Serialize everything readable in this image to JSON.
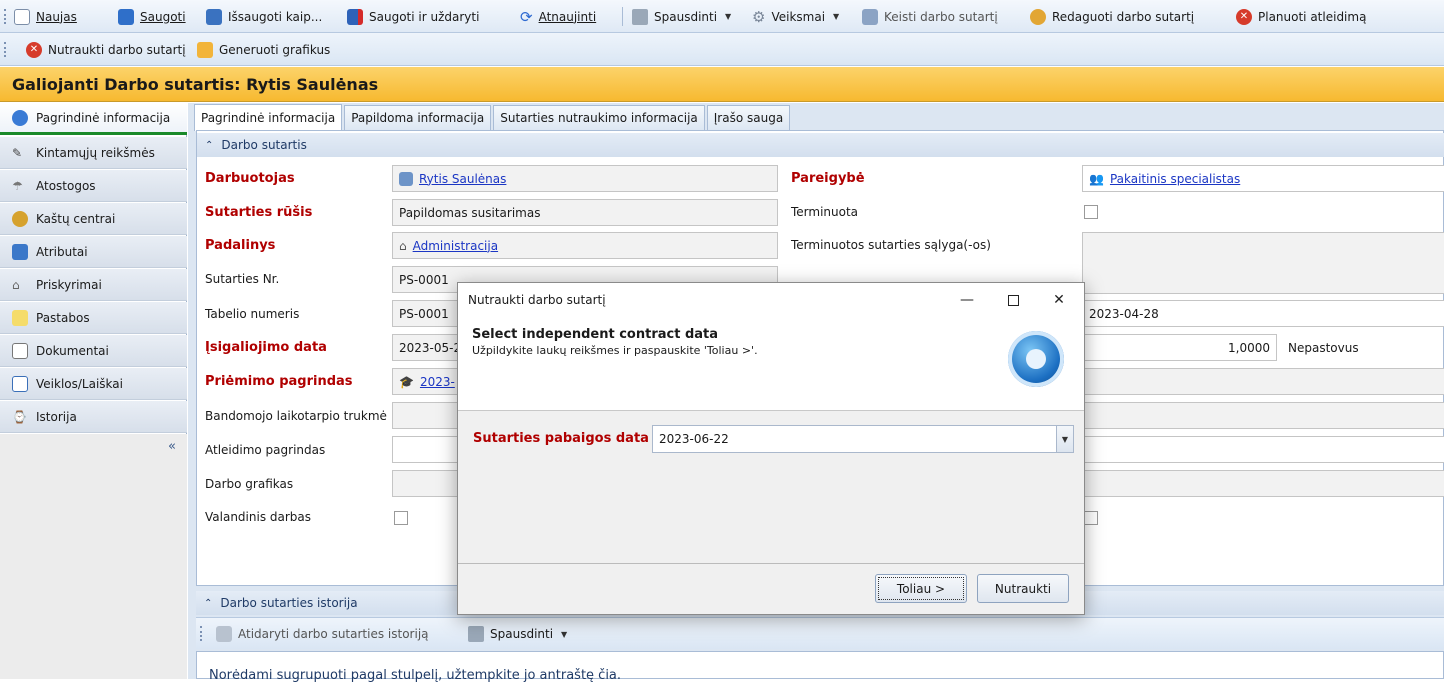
{
  "toolbar1": {
    "new": "Naujas",
    "save": "Saugoti",
    "save_as": "Išsaugoti kaip...",
    "save_close": "Saugoti ir uždaryti",
    "refresh": "Atnaujinti",
    "print": "Spausdinti",
    "actions": "Veiksmai",
    "change_contract": "Keisti darbo sutartį",
    "edit_contract": "Redaguoti darbo sutartį",
    "plan_dismissal": "Planuoti atleidimą"
  },
  "toolbar2": {
    "terminate": "Nutraukti darbo sutartį",
    "generate_schedules": "Generuoti grafikus"
  },
  "window_title": "Galiojanti Darbo sutartis: Rytis Saulėnas",
  "sidebar": {
    "items": [
      {
        "label": "Pagrindinė informacija",
        "icon": "database-icon"
      },
      {
        "label": "Kintamųjų reikšmės",
        "icon": "pencil-icon"
      },
      {
        "label": "Atostogos",
        "icon": "umbrella-icon"
      },
      {
        "label": "Kaštų centrai",
        "icon": "money-bag-icon"
      },
      {
        "label": "Atributai",
        "icon": "blocks-icon"
      },
      {
        "label": "Priskyrimai",
        "icon": "building-icon"
      },
      {
        "label": "Pastabos",
        "icon": "note-icon"
      },
      {
        "label": "Dokumentai",
        "icon": "documents-icon"
      },
      {
        "label": "Veiklos/Laiškai",
        "icon": "mail-icon"
      },
      {
        "label": "Istorija",
        "icon": "history-icon"
      }
    ],
    "collapse": "«"
  },
  "tabs": [
    "Pagrindinė informacija",
    "Papildoma informacija",
    "Sutarties nutraukimo informacija",
    "Įrašo sauga"
  ],
  "group_contract": "Darbo sutartis",
  "form": {
    "employee_label": "Darbuotojas",
    "employee_value": "Rytis Saulėnas",
    "contract_type_label": "Sutarties rūšis",
    "contract_type_value": "Papildomas susitarimas",
    "department_label": "Padalinys",
    "department_value": "Administracija",
    "contract_no_label": "Sutarties Nr.",
    "contract_no_value": "PS-0001",
    "tabel_label": "Tabelio numeris",
    "tabel_value": "PS-0001",
    "effective_date_label": "Įsigaliojimo data",
    "effective_date_value": "2023-05-2",
    "hire_basis_label": "Priėmimo pagrindas",
    "hire_basis_value": "2023-",
    "probation_label": "Bandomojo laikotarpio trukmė",
    "dismissal_basis_label": "Atleidimo pagrindas",
    "schedule_label": "Darbo grafikas",
    "hourly_label": "Valandinis darbas",
    "position_label": "Pareigybė",
    "position_value": "Pakaitinis specialistas",
    "fixed_term_label": "Terminuota",
    "fixed_term_conditions_label": "Terminuotos sutarties sąlyga(-os)",
    "right_date_value": "2023-04-28",
    "right_rate_value": "1,0000",
    "right_rate_type": "Nepastovus"
  },
  "group_history": "Darbo sutarties istorija",
  "history_toolbar": {
    "open_history": "Atidaryti darbo sutarties istoriją",
    "print": "Spausdinti"
  },
  "grid_hint": "Norėdami sugrupuoti pagal stulpelį, užtempkite jo antraštę čia.",
  "dialog": {
    "title": "Nutraukti darbo sutartį",
    "heading": "Select independent contract data",
    "subheading": "Užpildykite laukų reikšmes ir paspauskite 'Toliau >'.",
    "end_date_label": "Sutarties pabaigos data",
    "end_date_value": "2023-06-22",
    "next_button": "Toliau >",
    "cancel_button": "Nutraukti"
  }
}
